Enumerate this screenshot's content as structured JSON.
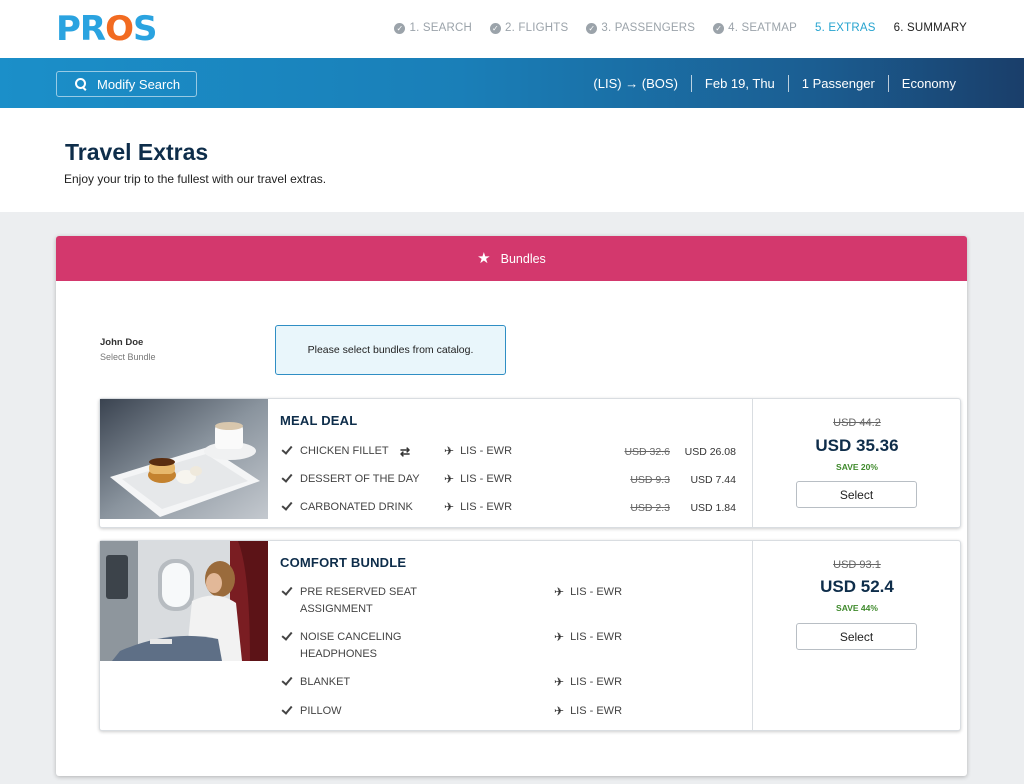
{
  "brand": {
    "logo_part1": "PR",
    "logo_part2": "O",
    "logo_part3": "S"
  },
  "steps": [
    {
      "label": "1. SEARCH"
    },
    {
      "label": "2. FLIGHTS"
    },
    {
      "label": "3. PASSENGERS"
    },
    {
      "label": "4. SEATMAP"
    },
    {
      "label": "5. EXTRAS"
    },
    {
      "label": "6. SUMMARY"
    }
  ],
  "searchbar": {
    "modify_label": "Modify Search",
    "route": "(LIS) → (BOS)",
    "date": "Feb 19, Thu",
    "passengers": "1 Passenger",
    "cabin": "Economy"
  },
  "page": {
    "title": "Travel Extras",
    "subtitle": "Enjoy your trip to the fullest with our travel extras."
  },
  "bundles": {
    "header": "Bundles",
    "passenger_name": "John Doe",
    "passenger_hint": "Select Bundle",
    "notice": "Please select bundles from catalog.",
    "cards": [
      {
        "title": "MEAL DEAL",
        "items": [
          {
            "label": "CHICKEN FILLET",
            "route": "LIS - EWR",
            "old_price": "USD 32.6",
            "price": "USD 26.08"
          },
          {
            "label": "DESSERT OF THE DAY",
            "route": "LIS - EWR",
            "old_price": "USD 9.3",
            "price": "USD 7.44"
          },
          {
            "label": "CARBONATED DRINK",
            "route": "LIS - EWR",
            "old_price": "USD 2.3",
            "price": "USD 1.84"
          }
        ],
        "old_total": "USD 44.2",
        "total": "USD 35.36",
        "save": "SAVE 20%",
        "select_label": "Select"
      },
      {
        "title": "COMFORT BUNDLE",
        "items": [
          {
            "label": "PRE RESERVED SEAT ASSIGNMENT",
            "route": "LIS - EWR"
          },
          {
            "label": "NOISE CANCELING HEADPHONES",
            "route": "LIS - EWR"
          },
          {
            "label": "BLANKET",
            "route": "LIS - EWR"
          },
          {
            "label": "PILLOW",
            "route": "LIS - EWR"
          }
        ],
        "old_total": "USD 93.1",
        "total": "USD 52.4",
        "save": "SAVE 44%",
        "select_label": "Select"
      }
    ]
  },
  "colors": {
    "bundle_header": "#d3386d",
    "active_step": "#26a3cf",
    "save_green": "#3f8a2c",
    "title_navy": "#0e2d4a"
  }
}
